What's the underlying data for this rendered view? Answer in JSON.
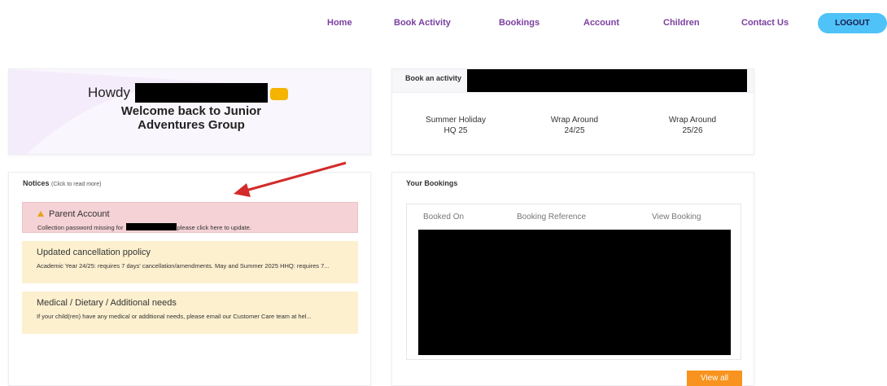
{
  "nav": {
    "items": [
      "Home",
      "Book Activity",
      "Bookings",
      "Account",
      "Children",
      "Contact Us"
    ],
    "logout_label": "LOGOUT"
  },
  "welcome": {
    "howdy": "Howdy",
    "line1": "Welcome back to Junior",
    "line2": "Adventures Group"
  },
  "book_activity": {
    "label": "Book an activity",
    "activities": [
      {
        "line1": "Summer Holiday",
        "line2": "HQ 25"
      },
      {
        "line1": "Wrap Around",
        "line2": "24/25"
      },
      {
        "line1": "Wrap Around",
        "line2": "25/26"
      }
    ]
  },
  "notices": {
    "title": "Notices",
    "hint": "(Click to read more)",
    "items": [
      {
        "title": "Parent Account",
        "body_before": "Collection password missing for",
        "body_after": "please click here to update."
      },
      {
        "title": "Updated cancellation ppolicy",
        "body": "Academic Year 24/25: requires 7 days' cancellation/amendments. May and Summer 2025 HHQ: requires 7..."
      },
      {
        "title": "Medical / Dietary / Additional needs",
        "body": "If your child(ren) have any medical or additional needs, please email our Customer Care team at hel..."
      }
    ]
  },
  "bookings": {
    "title": "Your Bookings",
    "columns": [
      "Booked On",
      "Booking Reference",
      "View Booking"
    ],
    "view_all_label": "View all"
  },
  "colors": {
    "accent_purple": "#7b3fa0",
    "logout_blue": "#4fc3f7",
    "view_all_orange": "#f7931e",
    "alert_red": "#f5d2d5",
    "notice_yellow": "#fdf0cf",
    "annotation_arrow": "#d42a2a"
  }
}
